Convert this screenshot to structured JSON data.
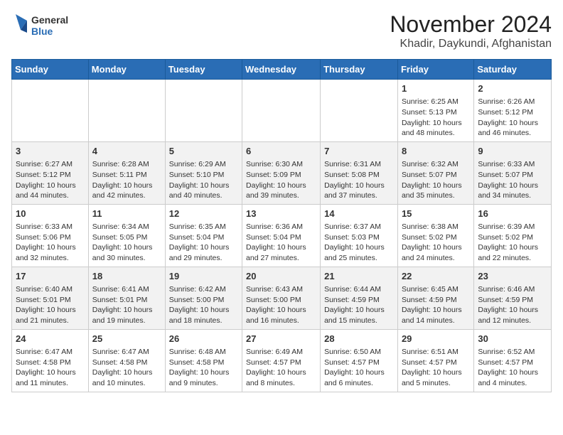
{
  "logo": {
    "line1": "General",
    "line2": "Blue"
  },
  "title": "November 2024",
  "subtitle": "Khadir, Daykundi, Afghanistan",
  "days_of_week": [
    "Sunday",
    "Monday",
    "Tuesday",
    "Wednesday",
    "Thursday",
    "Friday",
    "Saturday"
  ],
  "weeks": [
    [
      {
        "day": "",
        "info": ""
      },
      {
        "day": "",
        "info": ""
      },
      {
        "day": "",
        "info": ""
      },
      {
        "day": "",
        "info": ""
      },
      {
        "day": "",
        "info": ""
      },
      {
        "day": "1",
        "info": "Sunrise: 6:25 AM\nSunset: 5:13 PM\nDaylight: 10 hours and 48 minutes."
      },
      {
        "day": "2",
        "info": "Sunrise: 6:26 AM\nSunset: 5:12 PM\nDaylight: 10 hours and 46 minutes."
      }
    ],
    [
      {
        "day": "3",
        "info": "Sunrise: 6:27 AM\nSunset: 5:12 PM\nDaylight: 10 hours and 44 minutes."
      },
      {
        "day": "4",
        "info": "Sunrise: 6:28 AM\nSunset: 5:11 PM\nDaylight: 10 hours and 42 minutes."
      },
      {
        "day": "5",
        "info": "Sunrise: 6:29 AM\nSunset: 5:10 PM\nDaylight: 10 hours and 40 minutes."
      },
      {
        "day": "6",
        "info": "Sunrise: 6:30 AM\nSunset: 5:09 PM\nDaylight: 10 hours and 39 minutes."
      },
      {
        "day": "7",
        "info": "Sunrise: 6:31 AM\nSunset: 5:08 PM\nDaylight: 10 hours and 37 minutes."
      },
      {
        "day": "8",
        "info": "Sunrise: 6:32 AM\nSunset: 5:07 PM\nDaylight: 10 hours and 35 minutes."
      },
      {
        "day": "9",
        "info": "Sunrise: 6:33 AM\nSunset: 5:07 PM\nDaylight: 10 hours and 34 minutes."
      }
    ],
    [
      {
        "day": "10",
        "info": "Sunrise: 6:33 AM\nSunset: 5:06 PM\nDaylight: 10 hours and 32 minutes."
      },
      {
        "day": "11",
        "info": "Sunrise: 6:34 AM\nSunset: 5:05 PM\nDaylight: 10 hours and 30 minutes."
      },
      {
        "day": "12",
        "info": "Sunrise: 6:35 AM\nSunset: 5:04 PM\nDaylight: 10 hours and 29 minutes."
      },
      {
        "day": "13",
        "info": "Sunrise: 6:36 AM\nSunset: 5:04 PM\nDaylight: 10 hours and 27 minutes."
      },
      {
        "day": "14",
        "info": "Sunrise: 6:37 AM\nSunset: 5:03 PM\nDaylight: 10 hours and 25 minutes."
      },
      {
        "day": "15",
        "info": "Sunrise: 6:38 AM\nSunset: 5:02 PM\nDaylight: 10 hours and 24 minutes."
      },
      {
        "day": "16",
        "info": "Sunrise: 6:39 AM\nSunset: 5:02 PM\nDaylight: 10 hours and 22 minutes."
      }
    ],
    [
      {
        "day": "17",
        "info": "Sunrise: 6:40 AM\nSunset: 5:01 PM\nDaylight: 10 hours and 21 minutes."
      },
      {
        "day": "18",
        "info": "Sunrise: 6:41 AM\nSunset: 5:01 PM\nDaylight: 10 hours and 19 minutes."
      },
      {
        "day": "19",
        "info": "Sunrise: 6:42 AM\nSunset: 5:00 PM\nDaylight: 10 hours and 18 minutes."
      },
      {
        "day": "20",
        "info": "Sunrise: 6:43 AM\nSunset: 5:00 PM\nDaylight: 10 hours and 16 minutes."
      },
      {
        "day": "21",
        "info": "Sunrise: 6:44 AM\nSunset: 4:59 PM\nDaylight: 10 hours and 15 minutes."
      },
      {
        "day": "22",
        "info": "Sunrise: 6:45 AM\nSunset: 4:59 PM\nDaylight: 10 hours and 14 minutes."
      },
      {
        "day": "23",
        "info": "Sunrise: 6:46 AM\nSunset: 4:59 PM\nDaylight: 10 hours and 12 minutes."
      }
    ],
    [
      {
        "day": "24",
        "info": "Sunrise: 6:47 AM\nSunset: 4:58 PM\nDaylight: 10 hours and 11 minutes."
      },
      {
        "day": "25",
        "info": "Sunrise: 6:47 AM\nSunset: 4:58 PM\nDaylight: 10 hours and 10 minutes."
      },
      {
        "day": "26",
        "info": "Sunrise: 6:48 AM\nSunset: 4:58 PM\nDaylight: 10 hours and 9 minutes."
      },
      {
        "day": "27",
        "info": "Sunrise: 6:49 AM\nSunset: 4:57 PM\nDaylight: 10 hours and 8 minutes."
      },
      {
        "day": "28",
        "info": "Sunrise: 6:50 AM\nSunset: 4:57 PM\nDaylight: 10 hours and 6 minutes."
      },
      {
        "day": "29",
        "info": "Sunrise: 6:51 AM\nSunset: 4:57 PM\nDaylight: 10 hours and 5 minutes."
      },
      {
        "day": "30",
        "info": "Sunrise: 6:52 AM\nSunset: 4:57 PM\nDaylight: 10 hours and 4 minutes."
      }
    ]
  ]
}
